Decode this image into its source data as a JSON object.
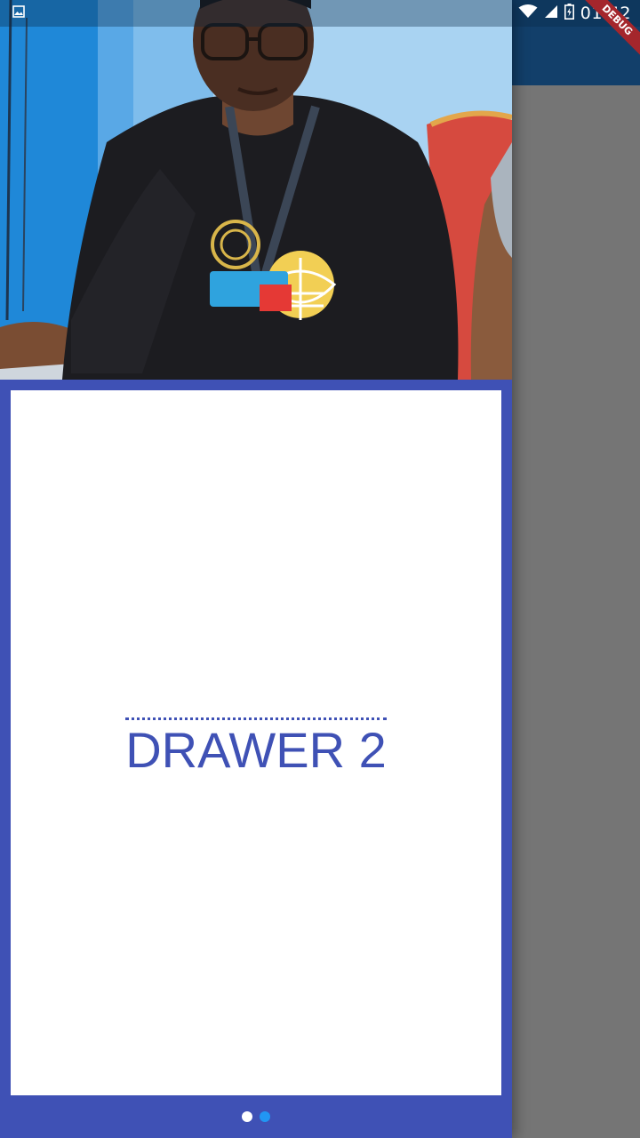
{
  "status_bar": {
    "time": "01:42",
    "left_icons": [
      "image-notification-icon"
    ],
    "right_icons": [
      "wifi-icon",
      "cell-signal-icon",
      "battery-charging-icon"
    ]
  },
  "debug_banner": {
    "label": "DEBUG"
  },
  "drawer": {
    "photo": {
      "subject": "person-photo"
    },
    "title": "DRAWER 2",
    "page_indicator": {
      "count": 2,
      "active_index": 0
    }
  },
  "colors": {
    "drawer_accent": "#3f51b5",
    "app_bar": "#123f6a",
    "scrim": "#757575",
    "indicator_active": "#ffffff",
    "indicator_inactive": "#2196f3",
    "debug_banner": "#a4262c"
  }
}
